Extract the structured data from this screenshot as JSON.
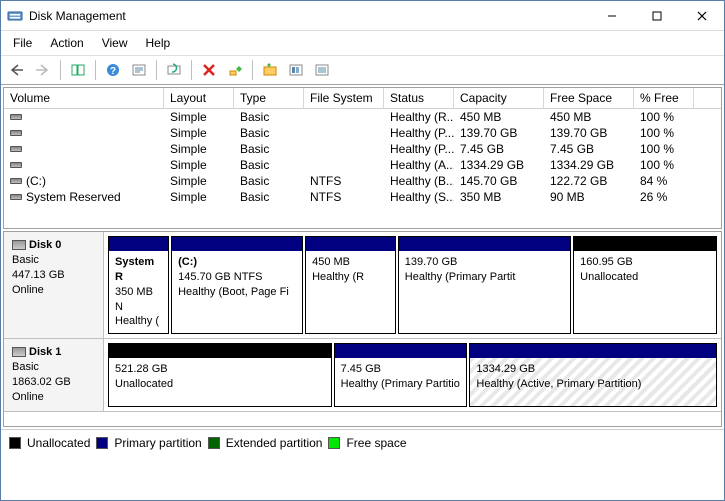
{
  "window": {
    "title": "Disk Management",
    "minimize_label": "Minimize",
    "maximize_label": "Maximize",
    "close_label": "Close"
  },
  "menu": {
    "file": "File",
    "action": "Action",
    "view": "View",
    "help": "Help"
  },
  "toolbar": {
    "back": "Back",
    "forward": "Forward",
    "show_hide": "Show/Hide",
    "help": "Help",
    "props": "Properties",
    "refresh": "Refresh",
    "delete": "Delete",
    "new": "New",
    "open": "Open",
    "settings": "Settings",
    "list": "List"
  },
  "volume_table": {
    "headers": {
      "volume": "Volume",
      "layout": "Layout",
      "type": "Type",
      "fs": "File System",
      "status": "Status",
      "capacity": "Capacity",
      "free": "Free Space",
      "pct": "% Free"
    },
    "rows": [
      {
        "volume": "",
        "layout": "Simple",
        "type": "Basic",
        "fs": "",
        "status": "Healthy (R...",
        "capacity": "450 MB",
        "free": "450 MB",
        "pct": "100 %"
      },
      {
        "volume": "",
        "layout": "Simple",
        "type": "Basic",
        "fs": "",
        "status": "Healthy (P...",
        "capacity": "139.70 GB",
        "free": "139.70 GB",
        "pct": "100 %"
      },
      {
        "volume": "",
        "layout": "Simple",
        "type": "Basic",
        "fs": "",
        "status": "Healthy (P...",
        "capacity": "7.45 GB",
        "free": "7.45 GB",
        "pct": "100 %"
      },
      {
        "volume": "",
        "layout": "Simple",
        "type": "Basic",
        "fs": "",
        "status": "Healthy (A...",
        "capacity": "1334.29 GB",
        "free": "1334.29 GB",
        "pct": "100 %"
      },
      {
        "volume": "(C:)",
        "layout": "Simple",
        "type": "Basic",
        "fs": "NTFS",
        "status": "Healthy (B...",
        "capacity": "145.70 GB",
        "free": "122.72 GB",
        "pct": "84 %"
      },
      {
        "volume": "System Reserved",
        "layout": "Simple",
        "type": "Basic",
        "fs": "NTFS",
        "status": "Healthy (S...",
        "capacity": "350 MB",
        "free": "90 MB",
        "pct": "26 %"
      }
    ]
  },
  "disks": [
    {
      "name": "Disk 0",
      "type": "Basic",
      "size": "447.13 GB",
      "state": "Online",
      "parts": [
        {
          "kind": "primary",
          "name": "System R",
          "line2": "350 MB N",
          "line3": "Healthy (",
          "flex": 10
        },
        {
          "kind": "primary",
          "name": "(C:)",
          "line2": "145.70 GB NTFS",
          "line3": "Healthy (Boot, Page Fi",
          "flex": 22
        },
        {
          "kind": "primary",
          "name": "",
          "line2": "450 MB",
          "line3": "Healthy (R",
          "flex": 15
        },
        {
          "kind": "primary",
          "name": "",
          "line2": "139.70 GB",
          "line3": "Healthy (Primary Partit",
          "flex": 29
        },
        {
          "kind": "unalloc",
          "name": "",
          "line2": "160.95 GB",
          "line3": "Unallocated",
          "flex": 24
        }
      ]
    },
    {
      "name": "Disk 1",
      "type": "Basic",
      "size": "1863.02 GB",
      "state": "Online",
      "parts": [
        {
          "kind": "unalloc",
          "name": "",
          "line2": "521.28 GB",
          "line3": "Unallocated",
          "flex": 37
        },
        {
          "kind": "primary",
          "name": "",
          "line2": "7.45 GB",
          "line3": "Healthy (Primary Partitio",
          "flex": 22
        },
        {
          "kind": "primary",
          "name": "",
          "line2": "1334.29 GB",
          "line3": "Healthy (Active, Primary Partition)",
          "flex": 41,
          "hatched": true
        }
      ]
    }
  ],
  "legend": {
    "unallocated": "Unallocated",
    "primary": "Primary partition",
    "extended": "Extended partition",
    "free": "Free space"
  }
}
